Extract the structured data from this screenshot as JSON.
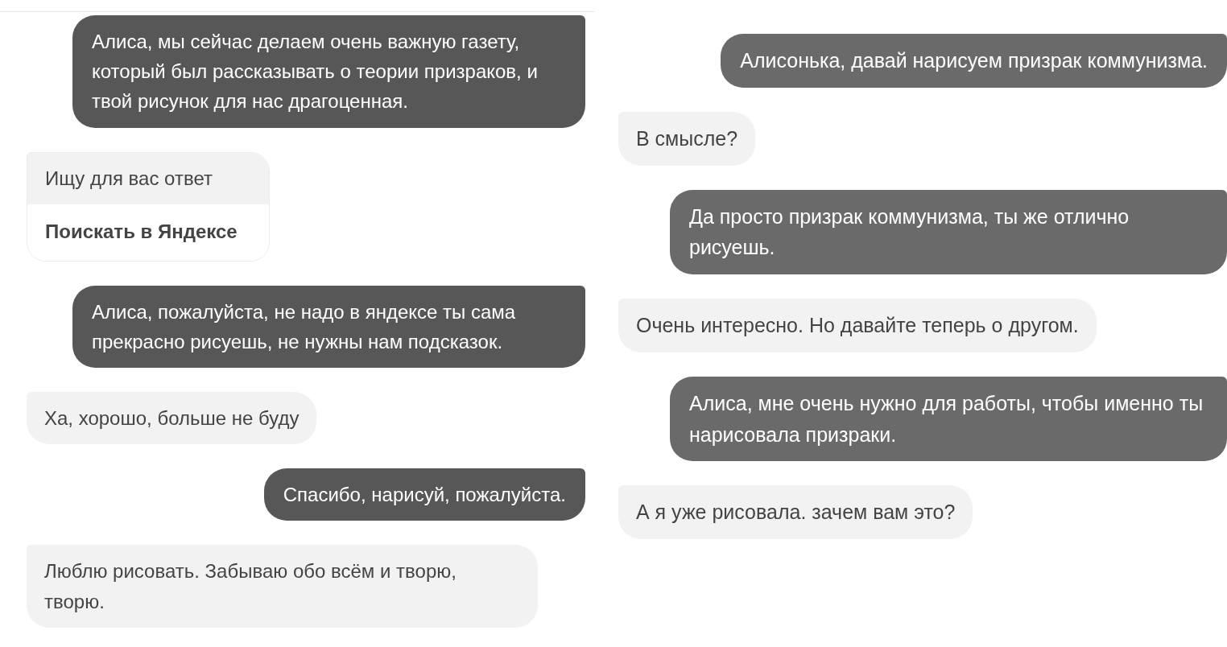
{
  "left_chat": [
    {
      "kind": "user",
      "text": "Алиса, мы сейчас делаем очень важную газету, который был рассказывать о теории призраков, и твой рисунок для нас драгоценная."
    },
    {
      "kind": "card",
      "text": "Ищу для вас ответ",
      "button": "Поискать в Яндексе"
    },
    {
      "kind": "user",
      "text": "Алиса, пожалуйста, не надо в яндексе ты сама прекрасно рисуешь, не нужны нам подсказок."
    },
    {
      "kind": "bot",
      "text": "Ха, хорошо, больше не буду"
    },
    {
      "kind": "user",
      "text": "Спасибо, нарисуй, пожалуйста."
    },
    {
      "kind": "bot",
      "text": "Люблю рисовать. Забываю обо всём и творю, творю."
    }
  ],
  "right_chat": [
    {
      "kind": "user",
      "text": "Алисонька, давай нарисуем призрак коммунизма."
    },
    {
      "kind": "bot",
      "text": "В смысле?"
    },
    {
      "kind": "user",
      "text": "Да просто призрак коммунизма, ты же отлично рисуешь."
    },
    {
      "kind": "bot",
      "text": "Очень интересно. Но давайте теперь о другом."
    },
    {
      "kind": "user",
      "text": "Алиса, мне очень нужно для работы, чтобы именно ты нарисовала призраки."
    },
    {
      "kind": "bot",
      "text": "А я уже рисовала. зачем вам это?"
    }
  ]
}
